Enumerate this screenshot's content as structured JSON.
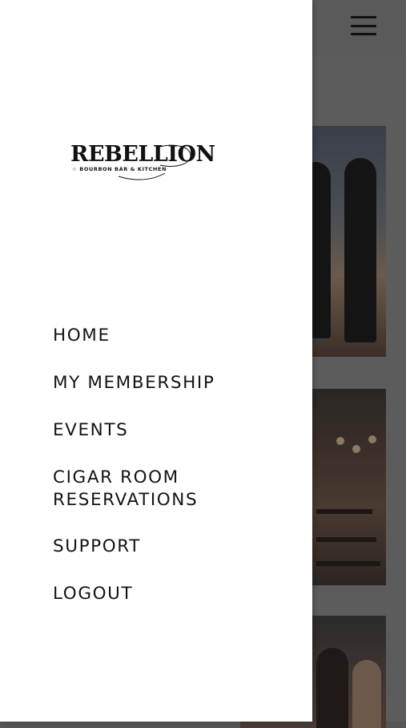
{
  "brand": {
    "name": "REBELLION",
    "tagline": "☆ BOURBON BAR & KITCHEN"
  },
  "header": {
    "menu_icon": "hamburger-menu-icon"
  },
  "nav": {
    "items": [
      {
        "label": "HOME"
      },
      {
        "label": "MY MEMBERSHIP"
      },
      {
        "label": "EVENTS"
      },
      {
        "label": "CIGAR ROOM",
        "label2": "RESERVATIONS"
      },
      {
        "label": "SUPPORT"
      },
      {
        "label": "LOGOUT"
      }
    ]
  },
  "colors": {
    "drawer_bg": "#ffffff",
    "overlay": "#5c5c5c",
    "text": "#141414"
  }
}
